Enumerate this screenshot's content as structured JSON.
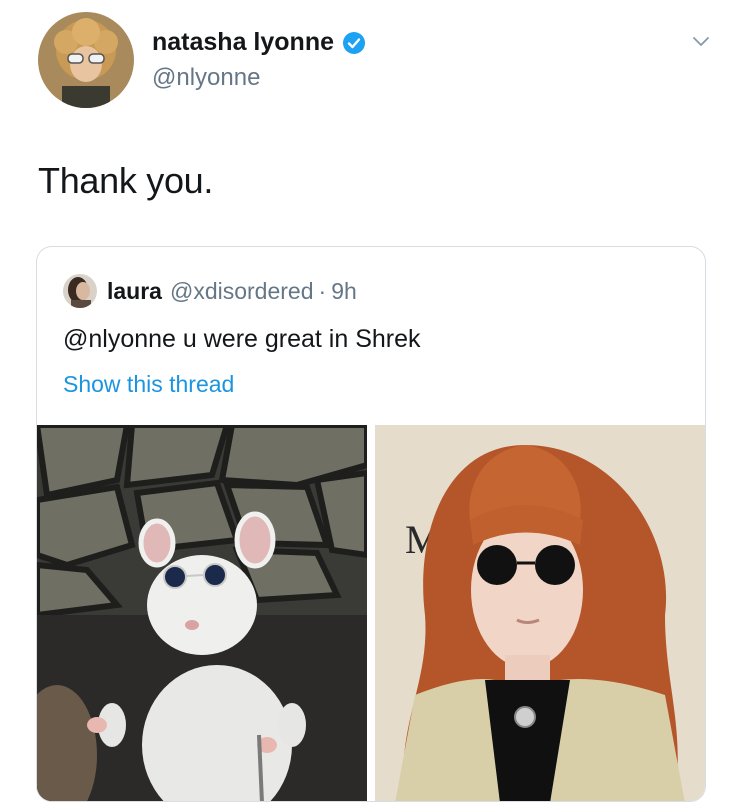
{
  "author": {
    "display_name": "natasha lyonne",
    "handle": "@nlyonne",
    "avatar_icon": "avatar-photo",
    "verified_icon": "verified-badge-icon"
  },
  "tweet": {
    "text": "Thank you."
  },
  "quoted_tweet": {
    "author_name": "laura",
    "handle": "@xdisordered",
    "separator": "·",
    "time": "9h",
    "text": "@nlyonne u were great in Shrek",
    "show_thread_label": "Show this thread",
    "media": [
      {
        "description_icon": "mouse-with-sunglasses-image"
      },
      {
        "description_icon": "woman-red-hair-sunglasses-image",
        "sign_letter": "M"
      }
    ]
  },
  "colors": {
    "text_primary": "#14171a",
    "text_secondary": "#657786",
    "link": "#1b95e0",
    "verified": "#1da1f2",
    "border": "#d7dde2"
  }
}
